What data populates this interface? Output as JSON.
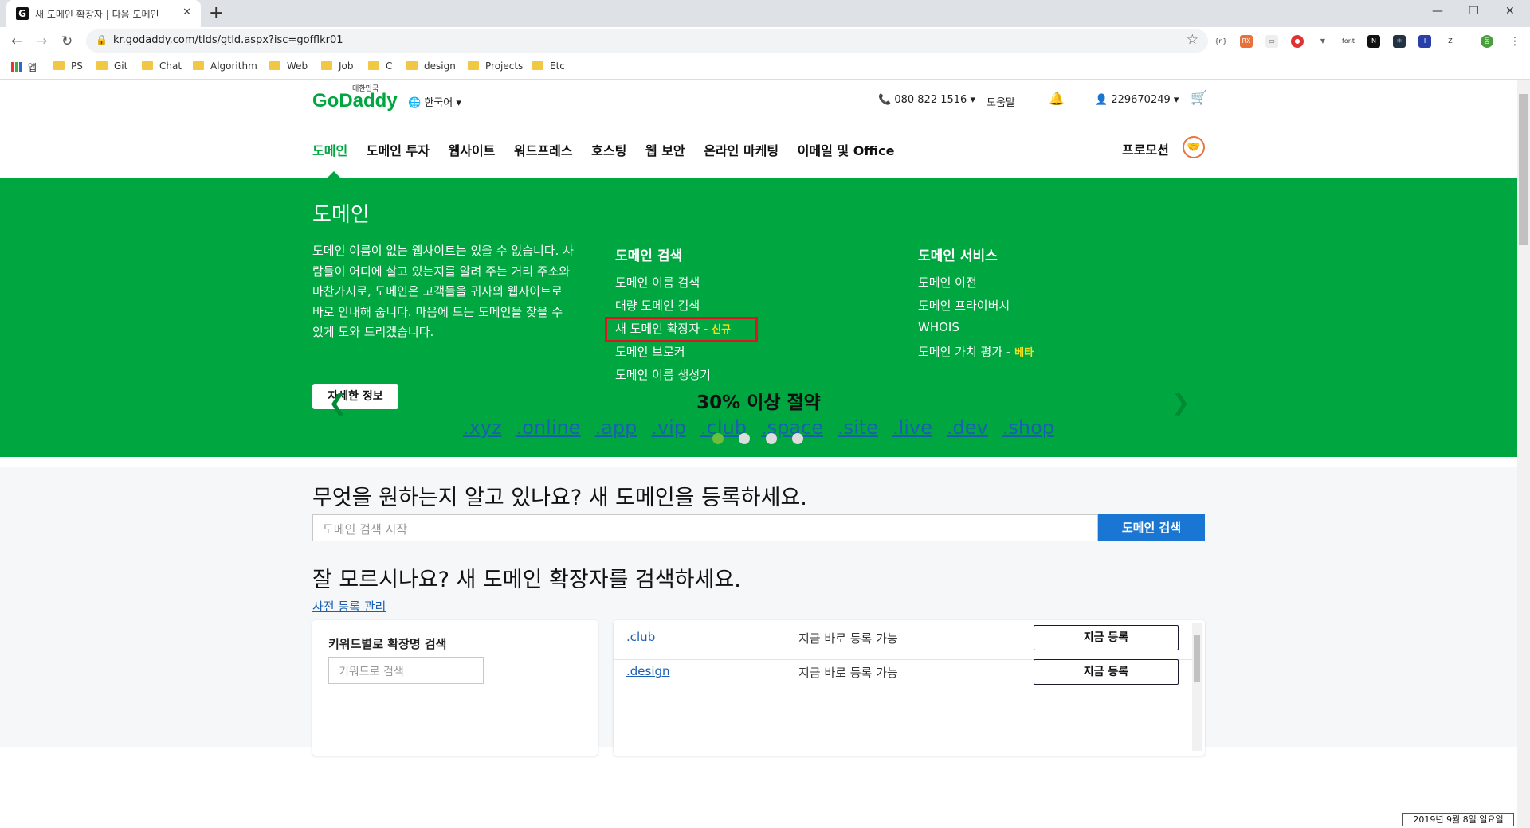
{
  "browser": {
    "tab_title": "새 도메인 확장자 | 다음 도메인",
    "tab_favicon": "G",
    "url": "kr.godaddy.com/tlds/gtld.aspx?isc=gofflkr01",
    "bookmarks": [
      "앱",
      "PS",
      "Git",
      "Chat",
      "Algorithm",
      "Web",
      "Job",
      "C",
      "design",
      "Projects",
      "Etc"
    ]
  },
  "header": {
    "logo": "GoDaddy",
    "logo_sub": "대한민국",
    "language": "한국어",
    "phone": "080 822 1516",
    "help": "도움말",
    "account": "229670249"
  },
  "nav": {
    "items": [
      "도메인",
      "도메인 투자",
      "웹사이트",
      "워드프레스",
      "호스팅",
      "웹 보안",
      "온라인 마케팅",
      "이메일 및 Office"
    ],
    "promo": "프로모션"
  },
  "mega": {
    "title": "도메인",
    "description": "도메인 이름이 없는 웹사이트는 있을 수 없습니다. 사람들이 어디에 살고 있는지를 알려 주는 거리 주소와 마찬가지로, 도메인은 고객들을 귀사의 웹사이트로 바로 안내해 줍니다. 마음에 드는 도메인을 찾을 수 있게 도와 드리겠습니다.",
    "more_button": "자세한 정보",
    "search_col": {
      "heading": "도메인 검색",
      "links": [
        "도메인 이름 검색",
        "대량 도메인 검색",
        "새 도메인 확장자 -",
        "도메인 브로커",
        "도메인 이름 생성기"
      ],
      "new_tag": "신규"
    },
    "services_col": {
      "heading": "도메인 서비스",
      "links": [
        "도메인 이전",
        "도메인 프라이버시",
        "WHOIS",
        "도메인 가치 평가 -"
      ],
      "beta_tag": "베타"
    }
  },
  "carousel": {
    "title": "30% 이상 절약",
    "tlds": [
      ".xyz",
      ".online",
      ".app",
      ".vip",
      ".club",
      ".space",
      ".site",
      ".live",
      ".dev",
      ".shop"
    ],
    "active_dot": 1,
    "dot_count": 4
  },
  "register": {
    "heading": "무엇을 원하는지 알고 있나요? 새 도메인을 등록하세요.",
    "search_placeholder": "도메인 검색 시작",
    "search_button": "도메인 검색",
    "heading2": "잘 모르시나요? 새 도메인 확장자를 검색하세요.",
    "prereg_link": "사전 등록 관리",
    "keyword_title": "키워드별로 확장명 검색",
    "keyword_placeholder": "키워드로 검색",
    "rows": [
      {
        "tld": ".club",
        "status": "지금 바로 등록 가능",
        "button": "지금 등록"
      },
      {
        "tld": ".design",
        "status": "지금 바로 등록 가능",
        "button": "지금 등록"
      }
    ]
  },
  "taskbar": {
    "date": "2019년 9월 8일 일요일"
  },
  "colors": {
    "brand_green": "#00a63f",
    "link_blue": "#1a5fb4",
    "button_blue": "#1976d2",
    "highlight_red": "#e0141e",
    "tag_yellow": "#f7e11d"
  }
}
